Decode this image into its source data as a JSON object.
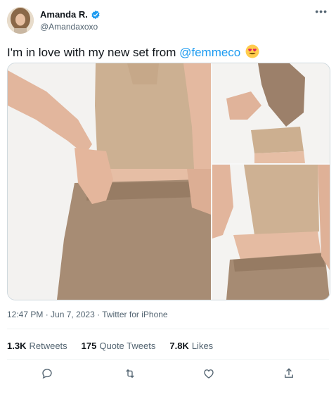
{
  "author": {
    "display_name": "Amanda R.",
    "handle": "@Amandaxoxo",
    "verified": true
  },
  "more_icon": "more-horizontal-icon",
  "tweet": {
    "text_before": "I'm in love with my new set from ",
    "mention": "@femmeco",
    "emoji": "heart-eyes-emoji"
  },
  "media": {
    "photo_count": 3,
    "tones": {
      "skin": "#e3b9a0",
      "top": "#cfb394",
      "pants": "#a58b73",
      "background": "#f3f2f0"
    }
  },
  "meta": {
    "time": "12:47 PM",
    "separator": " · ",
    "date": "Jun 7, 2023",
    "source": "Twitter for iPhone"
  },
  "stats": {
    "retweets": {
      "count": "1.3K",
      "label": "Retweets"
    },
    "quotes": {
      "count": "175",
      "label": "Quote Tweets"
    },
    "likes": {
      "count": "7.8K",
      "label": "Likes"
    }
  },
  "actions": [
    "reply-icon",
    "retweet-icon",
    "like-icon",
    "share-icon"
  ],
  "colors": {
    "accent": "#1d9bf0",
    "text": "#0f1419",
    "secondary": "#536471",
    "divider": "#eff3f4"
  }
}
